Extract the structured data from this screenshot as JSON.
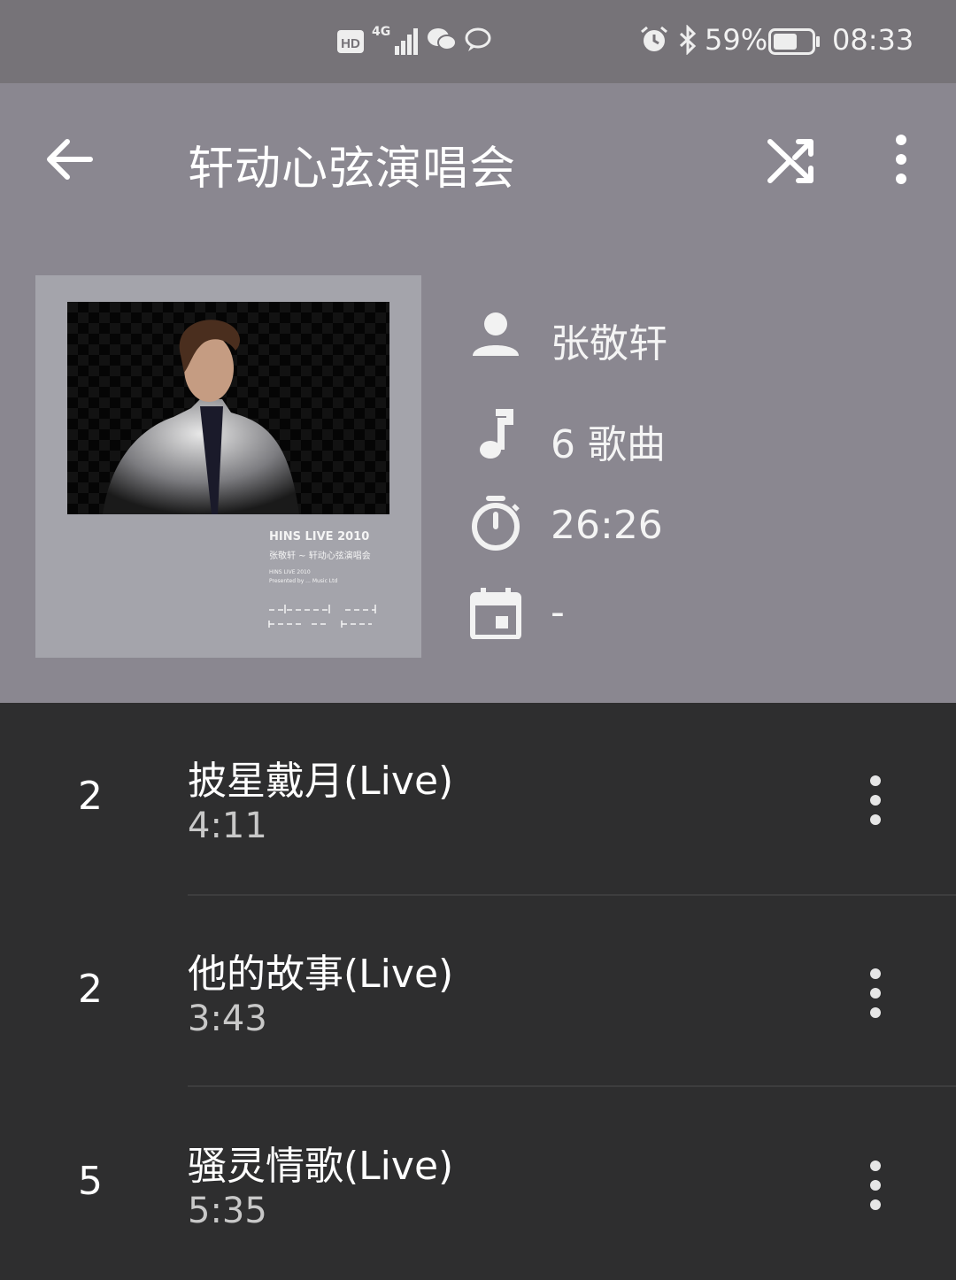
{
  "status_bar": {
    "hd_label": "HD",
    "network_label": "4G",
    "battery_percent": "59%",
    "time": "08:33",
    "icons": [
      "hd-icon",
      "signal-icon",
      "wechat-icon",
      "chat-bubble-icon",
      "alarm-icon",
      "bluetooth-icon",
      "battery-icon"
    ]
  },
  "app_bar": {
    "title": "轩动心弦演唱会",
    "icons": [
      "back-arrow-icon",
      "shuffle-icon",
      "more-vertical-icon"
    ]
  },
  "album": {
    "cover": {
      "line1": "HINS LIVE     2010",
      "line2": "张敬轩 ~ 轩动心弦演唱会",
      "line3": "HINS LIVE 2010",
      "line4": "Presented by ... Music Ltd"
    },
    "artist": "张敬轩",
    "song_count": "6 歌曲",
    "duration": "26:26",
    "date": "-"
  },
  "tracks": [
    {
      "number": "2",
      "title": "披星戴月(Live)",
      "duration": "4:11"
    },
    {
      "number": "2",
      "title": "他的故事(Live)",
      "duration": "3:43"
    },
    {
      "number": "5",
      "title": "骚灵情歌(Live)",
      "duration": "5:35"
    }
  ],
  "colors": {
    "header_bg": "#8a8790",
    "status_bg": "#767378",
    "list_bg": "#2e2e2f",
    "cover_frame": "#a4a4ab"
  }
}
